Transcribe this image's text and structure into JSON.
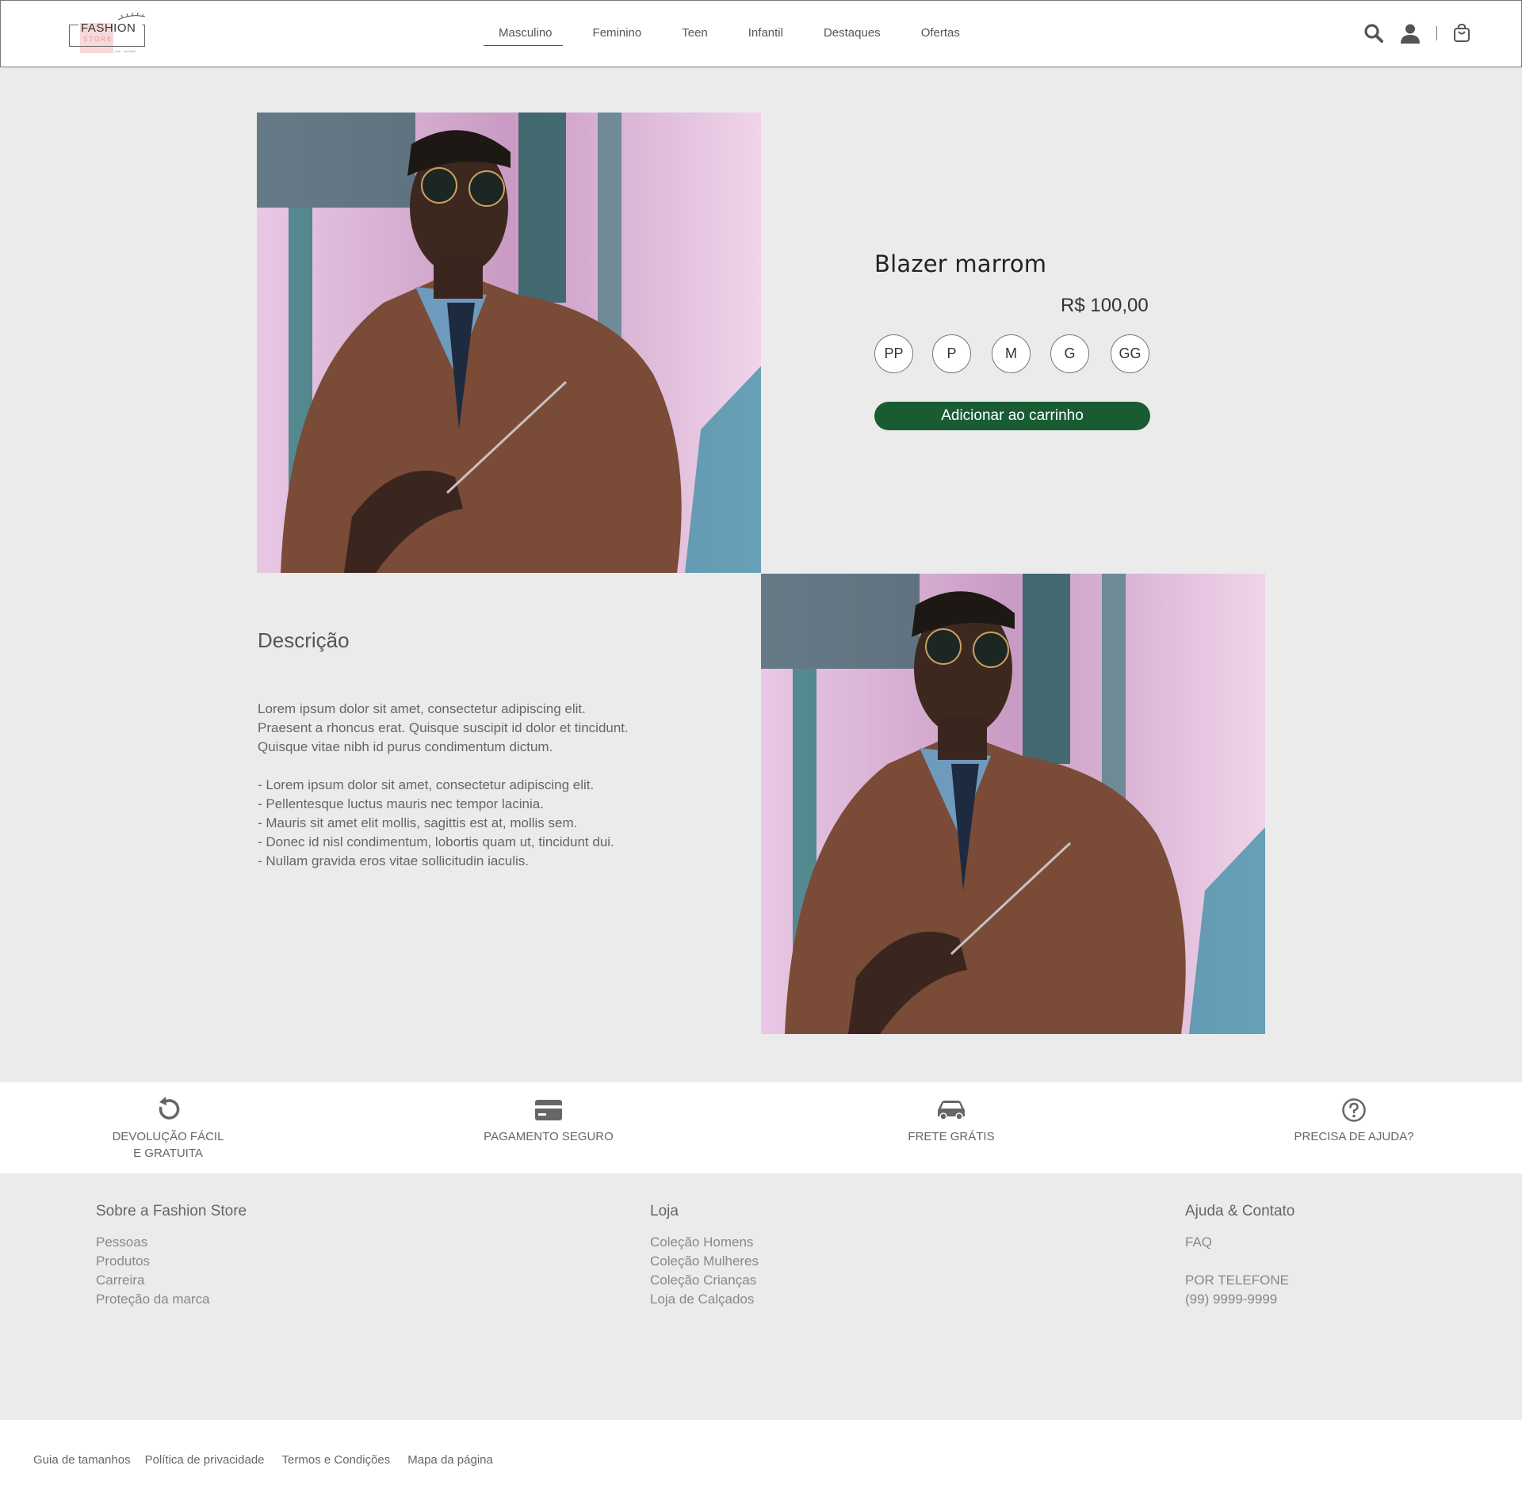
{
  "brand": {
    "line1": "FASHION",
    "line2": "STORE",
    "tagline": "look · beautiful"
  },
  "nav": {
    "items": [
      "Masculino",
      "Feminino",
      "Teen",
      "Infantil",
      "Destaques",
      "Ofertas"
    ],
    "active": "Masculino"
  },
  "header_icons": [
    "search-icon",
    "user-icon",
    "shopping-bag-icon"
  ],
  "product": {
    "title": "Blazer marrom",
    "price": "R$ 100,00",
    "sizes": [
      "PP",
      "P",
      "M",
      "G",
      "GG"
    ],
    "add_to_cart": "Adicionar ao carrinho",
    "button_color": "#195c33"
  },
  "description": {
    "title": "Descrição",
    "body": "Lorem ipsum dolor sit amet, consectetur adipiscing elit.\nPraesent a rhoncus erat. Quisque suscipit id dolor et tincidunt.\nQuisque vitae nibh id purus condimentum dictum.\n\n- Lorem ipsum dolor sit amet, consectetur adipiscing elit.\n- Pellentesque luctus mauris nec tempor lacinia.\n- Mauris sit amet elit mollis, sagittis est at, mollis sem.\n- Donec id nisl condimentum, lobortis quam ut, tincidunt dui.\n- Nullam gravida eros vitae sollicitudin iaculis."
  },
  "features": [
    {
      "icon": "return-arrow-icon",
      "label_line1": "DEVOLUÇÃO FÁCIL",
      "label_line2": "E GRATUITA"
    },
    {
      "icon": "credit-card-icon",
      "label_line1": "PAGAMENTO SEGURO",
      "label_line2": ""
    },
    {
      "icon": "car-icon",
      "label_line1": "FRETE GRÁTIS",
      "label_line2": ""
    },
    {
      "icon": "help-circle-icon",
      "label_line1": "PRECISA DE AJUDA?",
      "label_line2": ""
    }
  ],
  "footer": {
    "about": {
      "title": "Sobre a Fashion Store",
      "links": [
        "Pessoas",
        "Produtos",
        "Carreira",
        "Proteção da marca"
      ]
    },
    "store": {
      "title": "Loja",
      "links": [
        "Coleção Homens",
        "Coleção Mulheres",
        "Coleção Crianças",
        "Loja de Calçados"
      ]
    },
    "help": {
      "title": "Ajuda & Contato",
      "faq": "FAQ",
      "phone_label": "POR TELEFONE",
      "phone": "(99) 9999-9999"
    }
  },
  "bottom_links": [
    "Guia de tamanhos",
    "Política de privacidade",
    "Termos e Condições",
    "Mapa da página"
  ]
}
